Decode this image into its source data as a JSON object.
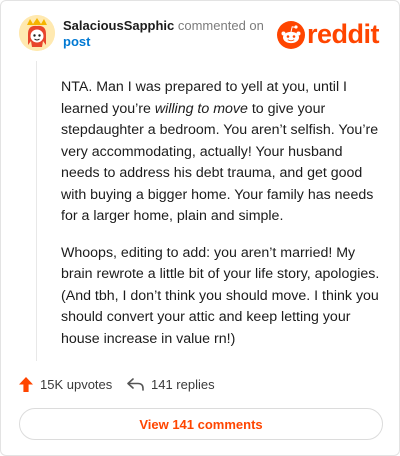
{
  "comment": {
    "username": "SalaciousSapphic",
    "action_text": " commented on",
    "post_link": "post",
    "brand": "reddit",
    "paragraph1": {
      "before": "NTA. Man I was prepared to yell at you, until I learned you’re ",
      "emphasis": "willing to move",
      "after": " to give your stepdaughter a bedroom. You aren’t selfish. You’re very accommodating, actually! Your husband needs to address his debt trauma, and get good with buying a bigger home. Your family has needs for a larger home, plain and simple."
    },
    "paragraph2": "Whoops, editing to add: you aren’t married! My brain rewrote a little bit of your life story, apologies. (And tbh, I don’t think you should move. I think you should convert your attic and keep letting your house increase in value rn!)",
    "upvotes": "15K upvotes",
    "replies": "141 replies",
    "view_button": "View 141 comments",
    "accent_color": "#ff4500",
    "link_color": "#0079d3"
  }
}
